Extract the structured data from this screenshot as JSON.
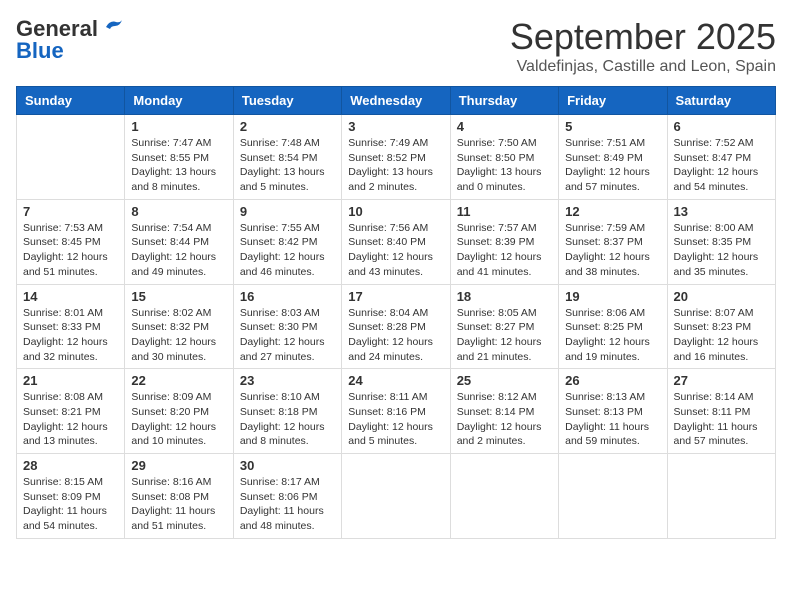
{
  "logo": {
    "line1": "General",
    "line2": "Blue"
  },
  "title": "September 2025",
  "subtitle": "Valdefinjas, Castille and Leon, Spain",
  "days_of_week": [
    "Sunday",
    "Monday",
    "Tuesday",
    "Wednesday",
    "Thursday",
    "Friday",
    "Saturday"
  ],
  "weeks": [
    [
      {
        "day": "",
        "info": ""
      },
      {
        "day": "1",
        "info": "Sunrise: 7:47 AM\nSunset: 8:55 PM\nDaylight: 13 hours\nand 8 minutes."
      },
      {
        "day": "2",
        "info": "Sunrise: 7:48 AM\nSunset: 8:54 PM\nDaylight: 13 hours\nand 5 minutes."
      },
      {
        "day": "3",
        "info": "Sunrise: 7:49 AM\nSunset: 8:52 PM\nDaylight: 13 hours\nand 2 minutes."
      },
      {
        "day": "4",
        "info": "Sunrise: 7:50 AM\nSunset: 8:50 PM\nDaylight: 13 hours\nand 0 minutes."
      },
      {
        "day": "5",
        "info": "Sunrise: 7:51 AM\nSunset: 8:49 PM\nDaylight: 12 hours\nand 57 minutes."
      },
      {
        "day": "6",
        "info": "Sunrise: 7:52 AM\nSunset: 8:47 PM\nDaylight: 12 hours\nand 54 minutes."
      }
    ],
    [
      {
        "day": "7",
        "info": "Sunrise: 7:53 AM\nSunset: 8:45 PM\nDaylight: 12 hours\nand 51 minutes."
      },
      {
        "day": "8",
        "info": "Sunrise: 7:54 AM\nSunset: 8:44 PM\nDaylight: 12 hours\nand 49 minutes."
      },
      {
        "day": "9",
        "info": "Sunrise: 7:55 AM\nSunset: 8:42 PM\nDaylight: 12 hours\nand 46 minutes."
      },
      {
        "day": "10",
        "info": "Sunrise: 7:56 AM\nSunset: 8:40 PM\nDaylight: 12 hours\nand 43 minutes."
      },
      {
        "day": "11",
        "info": "Sunrise: 7:57 AM\nSunset: 8:39 PM\nDaylight: 12 hours\nand 41 minutes."
      },
      {
        "day": "12",
        "info": "Sunrise: 7:59 AM\nSunset: 8:37 PM\nDaylight: 12 hours\nand 38 minutes."
      },
      {
        "day": "13",
        "info": "Sunrise: 8:00 AM\nSunset: 8:35 PM\nDaylight: 12 hours\nand 35 minutes."
      }
    ],
    [
      {
        "day": "14",
        "info": "Sunrise: 8:01 AM\nSunset: 8:33 PM\nDaylight: 12 hours\nand 32 minutes."
      },
      {
        "day": "15",
        "info": "Sunrise: 8:02 AM\nSunset: 8:32 PM\nDaylight: 12 hours\nand 30 minutes."
      },
      {
        "day": "16",
        "info": "Sunrise: 8:03 AM\nSunset: 8:30 PM\nDaylight: 12 hours\nand 27 minutes."
      },
      {
        "day": "17",
        "info": "Sunrise: 8:04 AM\nSunset: 8:28 PM\nDaylight: 12 hours\nand 24 minutes."
      },
      {
        "day": "18",
        "info": "Sunrise: 8:05 AM\nSunset: 8:27 PM\nDaylight: 12 hours\nand 21 minutes."
      },
      {
        "day": "19",
        "info": "Sunrise: 8:06 AM\nSunset: 8:25 PM\nDaylight: 12 hours\nand 19 minutes."
      },
      {
        "day": "20",
        "info": "Sunrise: 8:07 AM\nSunset: 8:23 PM\nDaylight: 12 hours\nand 16 minutes."
      }
    ],
    [
      {
        "day": "21",
        "info": "Sunrise: 8:08 AM\nSunset: 8:21 PM\nDaylight: 12 hours\nand 13 minutes."
      },
      {
        "day": "22",
        "info": "Sunrise: 8:09 AM\nSunset: 8:20 PM\nDaylight: 12 hours\nand 10 minutes."
      },
      {
        "day": "23",
        "info": "Sunrise: 8:10 AM\nSunset: 8:18 PM\nDaylight: 12 hours\nand 8 minutes."
      },
      {
        "day": "24",
        "info": "Sunrise: 8:11 AM\nSunset: 8:16 PM\nDaylight: 12 hours\nand 5 minutes."
      },
      {
        "day": "25",
        "info": "Sunrise: 8:12 AM\nSunset: 8:14 PM\nDaylight: 12 hours\nand 2 minutes."
      },
      {
        "day": "26",
        "info": "Sunrise: 8:13 AM\nSunset: 8:13 PM\nDaylight: 11 hours\nand 59 minutes."
      },
      {
        "day": "27",
        "info": "Sunrise: 8:14 AM\nSunset: 8:11 PM\nDaylight: 11 hours\nand 57 minutes."
      }
    ],
    [
      {
        "day": "28",
        "info": "Sunrise: 8:15 AM\nSunset: 8:09 PM\nDaylight: 11 hours\nand 54 minutes."
      },
      {
        "day": "29",
        "info": "Sunrise: 8:16 AM\nSunset: 8:08 PM\nDaylight: 11 hours\nand 51 minutes."
      },
      {
        "day": "30",
        "info": "Sunrise: 8:17 AM\nSunset: 8:06 PM\nDaylight: 11 hours\nand 48 minutes."
      },
      {
        "day": "",
        "info": ""
      },
      {
        "day": "",
        "info": ""
      },
      {
        "day": "",
        "info": ""
      },
      {
        "day": "",
        "info": ""
      }
    ]
  ]
}
